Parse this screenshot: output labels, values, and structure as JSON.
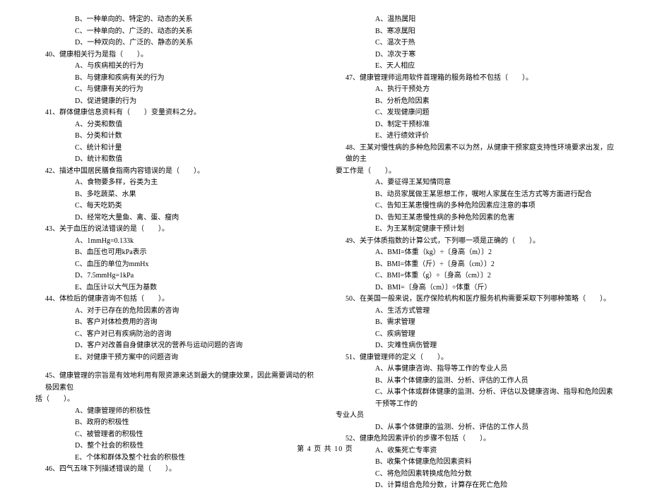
{
  "left_col": {
    "pre_opts": [
      "B、一种单向的、特定的、动态的关系",
      "C、一种单向的、广泛的、动态的关系",
      "D、一种双向的、广泛的、静态的关系"
    ],
    "q40": {
      "stem": "40、健康相关行为是指（　　）。",
      "opts": [
        "A、与疾病相关的行为",
        "B、与健康和疾病有关的行为",
        "C、与健康有关的行为",
        "D、促进健康的行为"
      ]
    },
    "q41": {
      "stem": "41、群体健康信息资料有（　　）变量资料之分。",
      "opts": [
        "A、分类和数值",
        "B、分类和计数",
        "C、统计和计量",
        "D、统计和数值"
      ]
    },
    "q42": {
      "stem": "42、描述中国居民膳食指南内容错误的是（　　）。",
      "opts": [
        "A、食物要多样，谷类为主",
        "B、多吃蔬菜、水果",
        "C、每天吃奶类",
        "D、经常吃大量鱼、禽、蛋、瘦肉"
      ]
    },
    "q43": {
      "stem": "43、关于血压的说法错误的是（　　）。",
      "opts": [
        "A、1mmHg=0.133k",
        "B、血压也可用kPa表示",
        "C、血压的单位为mmHx",
        "D、7.5mmHg=1kPa",
        "E、血压计以大气压为基数"
      ]
    },
    "q44": {
      "stem": "44、体检后的健康咨询不包括（　　）。",
      "opts": [
        "A、对于已存在的危险因素的咨询",
        "B、客户对体检费用的咨询",
        "C、客户对已有疾病防治的咨询",
        "D、客户对改善自身健康状况的营养与运动问题的咨询",
        "E、对健康干预方案中的问题咨询"
      ]
    },
    "q45": {
      "stem1": "45、健康管理的宗旨是有效地利用有限资源来达到最大的健康效果，因此需要调动的积极因素包",
      "stem2": "括（　　）。",
      "opts": [
        "A、健康管理师的积极性",
        "B、政府的积极性",
        "C、被管理者的积极性",
        "D、整个社会的积极性",
        "E、个体和群体及整个社会的积极性"
      ]
    },
    "q46": {
      "stem": "46、四气五味下列描述错误的是（　　）。"
    }
  },
  "right_col": {
    "pre_opts": [
      "A、温热属阳",
      "B、寒凉属阳",
      "C、温次于热",
      "D、凉次于寒",
      "E、天人相应"
    ],
    "q47": {
      "stem": "47、健康管理师运用软件首理箱的服务路检不包括（　　）。",
      "opts": [
        "A、执行干预处方",
        "B、分析危险因素",
        "C、发现健康问题",
        "D、制定干预标准",
        "E、进行绩效评价"
      ]
    },
    "q48": {
      "stem1": "48、王某对慢性病的多种危险因素不以为然，从健康干预家庭支持性环境要求出发，应做的主",
      "stem2": "要工作是（　　）。",
      "opts": [
        "A、要征得王某知情同意",
        "B、动员家属做王某思想工作，嘱咐人家属在生活方式等方面进行配合",
        "C、告知王某患慢性病的多种危险因素应注意的事项",
        "D、告知王某患慢性病的多种危险因素的危害",
        "E、为王某制定健康干预计划"
      ]
    },
    "q49": {
      "stem": "49、关于体质指数的计算公式，下列哪一项是正确的（　　）。",
      "opts": [
        "A、BMI=体重（kg）÷〔身高（m）〕2",
        "B、BMI=体重（斤）÷〔身高（cm）〕2",
        "C、BMI=体重（g）÷〔身高（cm）〕2",
        "D、BMI=〔身高（cm）〕÷体重（斤）"
      ]
    },
    "q50": {
      "stem": "50、在美国一般来说，医疗保险机构和医疗服务机构需要采取下列哪种策略（　　）。",
      "opts": [
        "A、生活方式管理",
        "B、需求管理",
        "C、疾病管理",
        "D、灾难性病伤管理"
      ]
    },
    "q51": {
      "stem": "51、健康管理师的定义（　　）。",
      "opts": [
        "A、从事健康咨询、指导等工作的专业人员",
        "B、从事个体健康的监测、分析、评估的工作人员"
      ],
      "optC1": "C、从事个体或群体健康的监测、分析、评估以及健康咨询、指导和危险因素干预等工作的",
      "optC2": "专业人员",
      "opts2": [
        "D、从事个体健康的监测、分析、评估的工作人员"
      ]
    },
    "q52": {
      "stem": "52、健康危险因素评价的步骤不包括（　　）。",
      "opts": [
        "A、收集死亡专率资",
        "B、收集个体健康危险因素资料",
        "C、将危险因素转换成危险分数",
        "D、计算组合危险分数，计算存在死亡危险"
      ]
    }
  },
  "footer": "第 4 页 共 10 页"
}
